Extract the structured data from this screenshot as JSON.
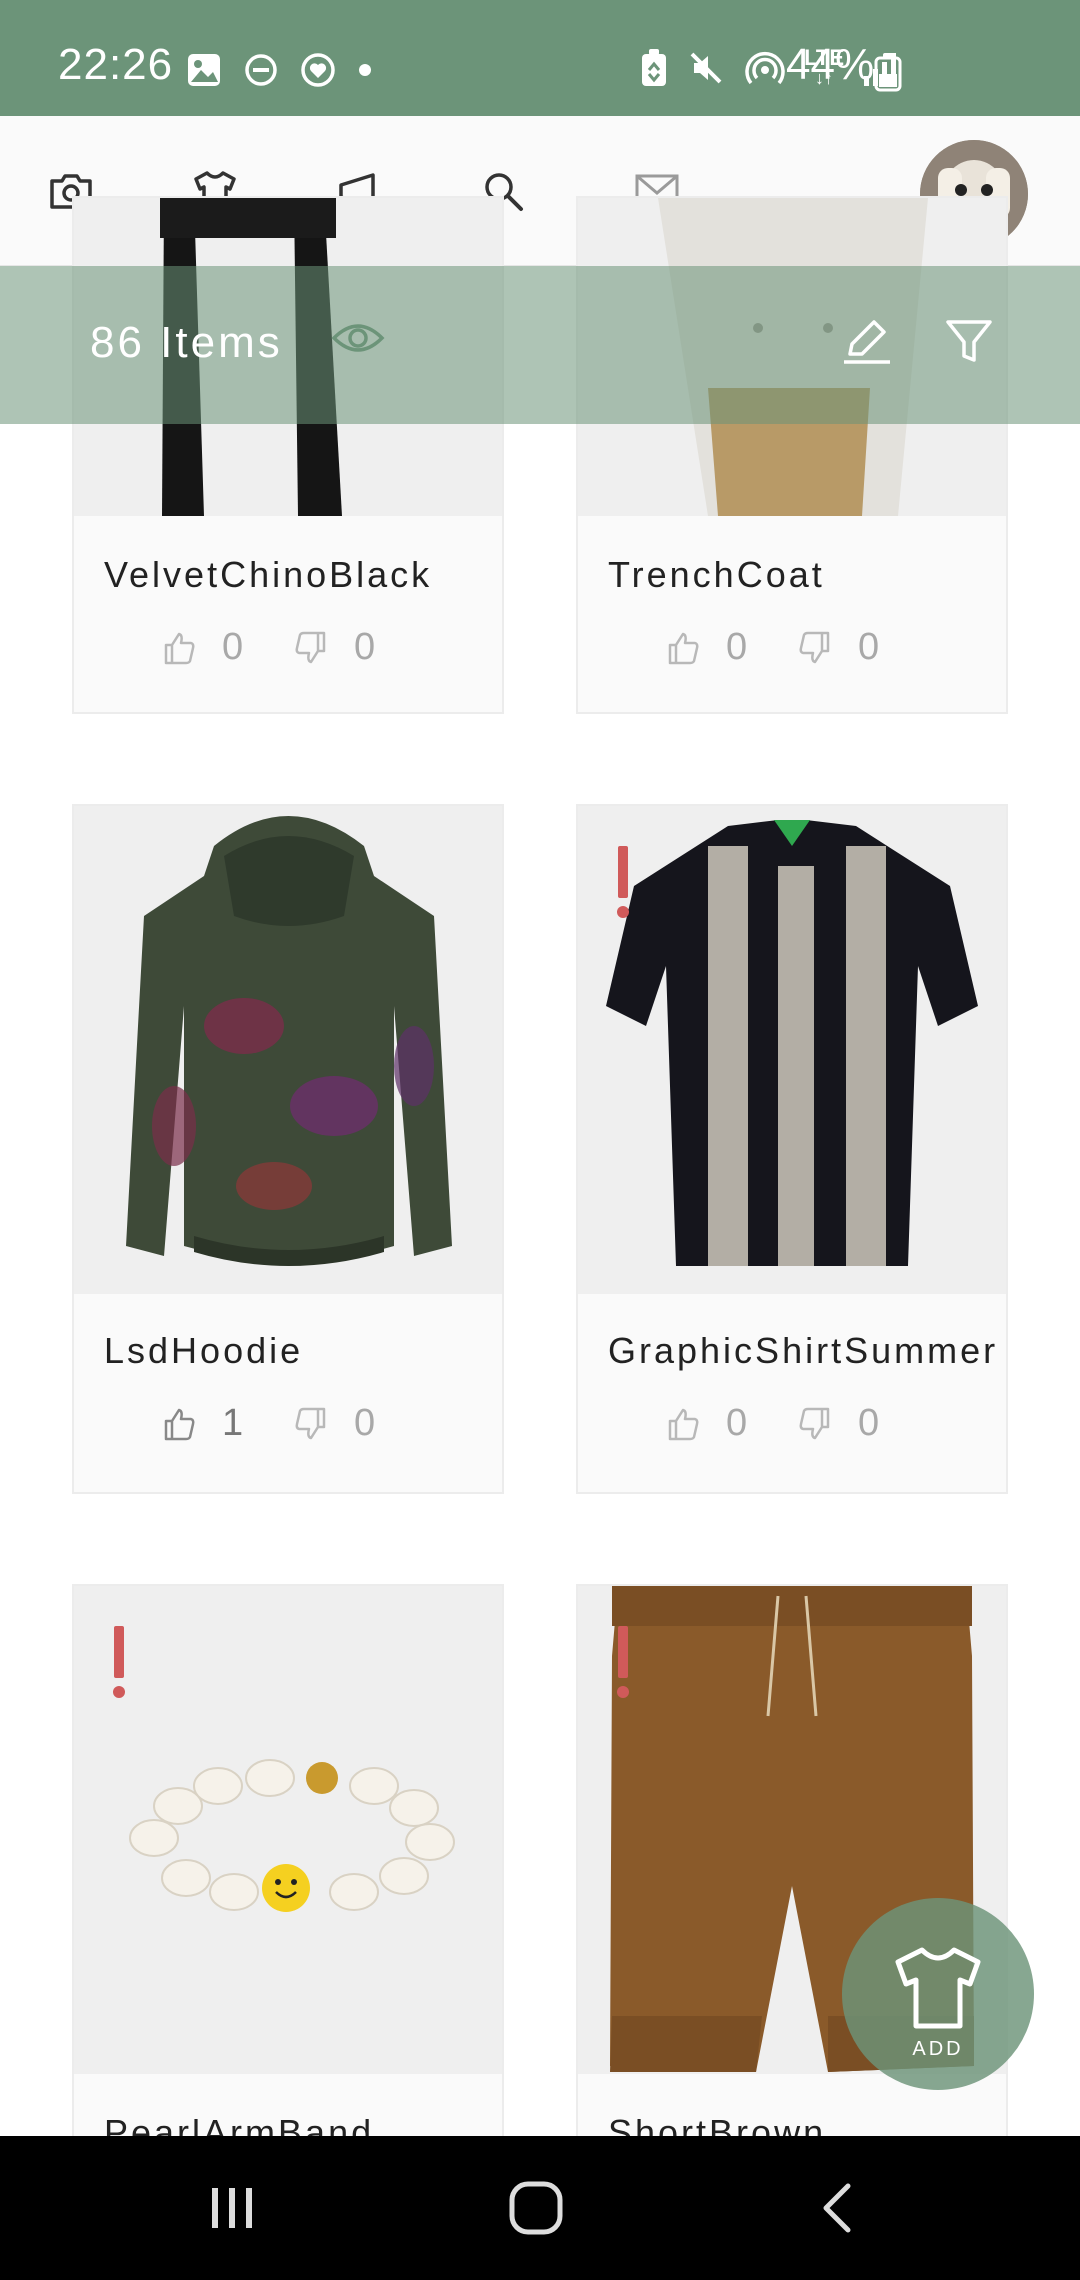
{
  "status_bar": {
    "time": "22:26",
    "battery_percent": "44%",
    "network": "LTE",
    "background_color": "#6c9479"
  },
  "nav": {
    "tabs": [
      {
        "icon": "camera-icon",
        "selected": false
      },
      {
        "icon": "tshirt-icon",
        "selected": true
      },
      {
        "icon": "megaphone-icon",
        "selected": false
      },
      {
        "icon": "search-icon",
        "selected": false
      },
      {
        "icon": "mail-icon",
        "selected": false
      }
    ],
    "avatar": "avatar"
  },
  "filter_bar": {
    "items_count": "86 Items",
    "icons": [
      "eye-icon",
      "edit-icon",
      "filter-icon"
    ]
  },
  "items": [
    {
      "name": "VelvetChinoBlack",
      "likes": "0",
      "dislikes": "0",
      "flagged": false
    },
    {
      "name": "TrenchCoat",
      "likes": "0",
      "dislikes": "0",
      "flagged": false
    },
    {
      "name": "LsdHoodie",
      "likes": "1",
      "dislikes": "0",
      "flagged": false
    },
    {
      "name": "GraphicShirtSummer",
      "likes": "0",
      "dislikes": "0",
      "flagged": true
    },
    {
      "name": "PearlArmBand",
      "likes": "",
      "dislikes": "",
      "flagged": true
    },
    {
      "name": "ShortBrown",
      "likes": "",
      "dislikes": "",
      "flagged": true
    }
  ],
  "fab": {
    "label": "ADD",
    "icon": "tshirt-icon"
  },
  "colors": {
    "accent": "#6c9479",
    "alert": "#d05a5a"
  }
}
